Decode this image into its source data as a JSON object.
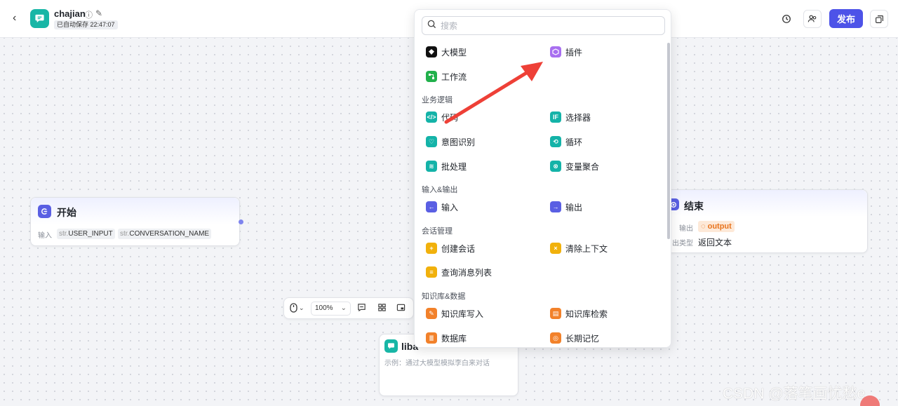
{
  "header": {
    "back_icon": "chevron-left-icon",
    "app_name": "chajian",
    "save_status": "已自动保存 22:47:07",
    "publish_label": "发布",
    "history_icon": "history-icon",
    "collab_icon": "users-icon",
    "layout_icon": "copy-icon"
  },
  "start_node": {
    "title": "开始",
    "input_label": "输入",
    "params": [
      {
        "type": "str.",
        "name": "USER_INPUT"
      },
      {
        "type": "str.",
        "name": "CONVERSATION_NAME"
      }
    ]
  },
  "end_node": {
    "title": "结束",
    "output_label": "输出",
    "output_value": "output",
    "type_label": "出类型",
    "type_value": "返回文本"
  },
  "bottom_node": {
    "title": "liba",
    "desc": "示例：通过大模型模拟李白来对话"
  },
  "zoom": {
    "level": "100%"
  },
  "node_panel": {
    "search_placeholder": "搜索",
    "top_items": [
      {
        "label": "大模型",
        "color": "#111111"
      },
      {
        "label": "插件",
        "color": "#a86ff0"
      },
      {
        "label": "工作流",
        "color": "#22b14c"
      }
    ],
    "sections": [
      {
        "title": "业务逻辑",
        "items": [
          {
            "label": "代码",
            "color": "#14b3a8"
          },
          {
            "label": "选择器",
            "color": "#14b3a8"
          },
          {
            "label": "意图识别",
            "color": "#14b3a8"
          },
          {
            "label": "循环",
            "color": "#14b3a8"
          },
          {
            "label": "批处理",
            "color": "#14b3a8"
          },
          {
            "label": "变量聚合",
            "color": "#14b3a8"
          }
        ]
      },
      {
        "title": "输入&输出",
        "items": [
          {
            "label": "输入",
            "color": "#5a5fe3"
          },
          {
            "label": "输出",
            "color": "#5a5fe3"
          }
        ]
      },
      {
        "title": "会话管理",
        "items": [
          {
            "label": "创建会话",
            "color": "#f1b10c"
          },
          {
            "label": "清除上下文",
            "color": "#f1b10c"
          },
          {
            "label": "查询消息列表",
            "color": "#f1b10c"
          }
        ]
      },
      {
        "title": "知识库&数据",
        "items": [
          {
            "label": "知识库写入",
            "color": "#f2812a"
          },
          {
            "label": "知识库检索",
            "color": "#f2812a"
          },
          {
            "label": "数据库",
            "color": "#f2812a"
          },
          {
            "label": "长期记忆",
            "color": "#f2812a"
          }
        ]
      }
    ]
  },
  "annotation": {
    "arrow_color": "#ee4037"
  },
  "watermark": "CSDN @落笔画忧愁e"
}
